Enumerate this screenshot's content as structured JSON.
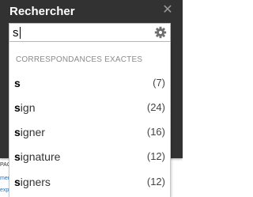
{
  "panel": {
    "title": "Rechercher",
    "close_symbol": "✕",
    "close_icon": "close-icon",
    "settings_icon": "gear-icon"
  },
  "search": {
    "value": "s",
    "placeholder": ""
  },
  "dropdown": {
    "section_header": "CORRESPONDANCES EXACTES",
    "results": [
      {
        "match": "s",
        "rest": "",
        "count": "(7)"
      },
      {
        "match": "s",
        "rest": "ign",
        "count": "(24)"
      },
      {
        "match": "s",
        "rest": "igner",
        "count": "(16)"
      },
      {
        "match": "s",
        "rest": "ignature",
        "count": "(12)"
      },
      {
        "match": "s",
        "rest": "igners",
        "count": "(12)"
      }
    ]
  },
  "background_page": {
    "fragments": [
      "PAC",
      "mer",
      "expe"
    ]
  },
  "colors": {
    "panel_bg": "#323232",
    "link": "#2a6db5"
  }
}
